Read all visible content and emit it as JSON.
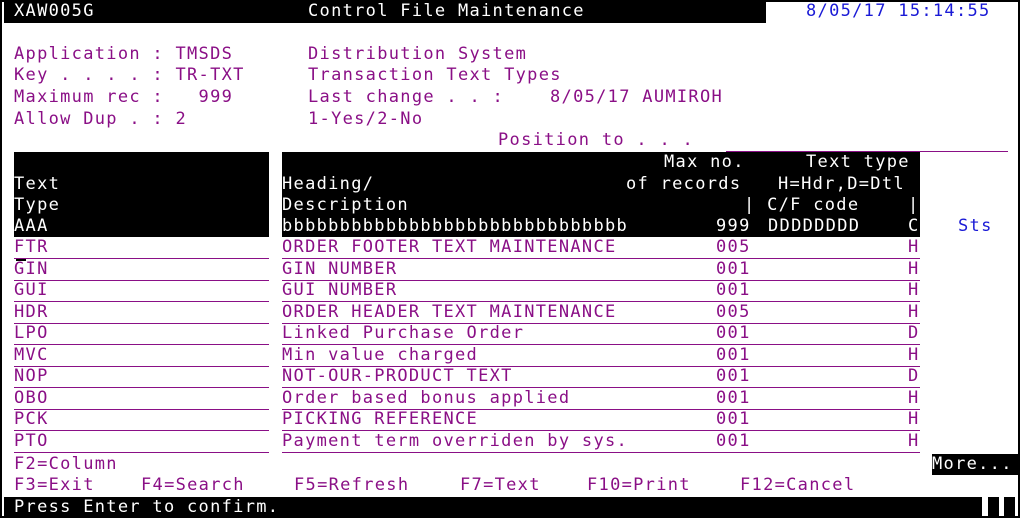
{
  "header": {
    "program": "XAW005G",
    "title": "Control File Maintenance",
    "datetime": "8/05/17 15:14:55"
  },
  "info": {
    "application_label": "Application : TMSDS",
    "application_desc": "Distribution System",
    "key_label": "Key . . . . : TR-TXT",
    "key_desc": "Transaction Text Types",
    "maxrec_label": "Maximum rec :   999",
    "last_change_label": "Last change . . :",
    "last_change_value": "8/05/17 AUMIROH",
    "allowdup_label": "Allow Dup . : 2",
    "allowdup_desc": "1-Yes/2-No"
  },
  "position_to": {
    "label": "Position to . . .",
    "value": ""
  },
  "columns": {
    "text_l2": "Text",
    "text_l3": "Type",
    "text_l4": "AAA",
    "heading_l2": "Heading/",
    "heading_l3": "Description",
    "heading_l4": "bbbbbbbbbbbbbbbbbbbbbbbbbbbbbb",
    "maxno_l1": "Max no.",
    "maxno_l2": "of records",
    "maxno_l4": "999",
    "texttype_l1": "Text type",
    "texttype_l2": "H=Hdr,D=Dtl",
    "cfcode_l3": "| C/F code",
    "cfcode_l4": "DDDDDDDD",
    "pipe_right": "|",
    "c_l4": "C",
    "sts": "Sts"
  },
  "rows": [
    {
      "type": "FTR",
      "description": "ORDER FOOTER TEXT MAINTENANCE",
      "max": "005",
      "cf": "",
      "hd": "H"
    },
    {
      "type": "GIN",
      "description": "GIN NUMBER",
      "max": "001",
      "cf": "",
      "hd": "H"
    },
    {
      "type": "GUI",
      "description": "GUI NUMBER",
      "max": "001",
      "cf": "",
      "hd": "H"
    },
    {
      "type": "HDR",
      "description": "ORDER HEADER TEXT MAINTENANCE",
      "max": "005",
      "cf": "",
      "hd": "H"
    },
    {
      "type": "LPO",
      "description": "Linked Purchase Order",
      "max": "001",
      "cf": "",
      "hd": "D"
    },
    {
      "type": "MVC",
      "description": "Min value charged",
      "max": "001",
      "cf": "",
      "hd": "H"
    },
    {
      "type": "NOP",
      "description": "NOT-OUR-PRODUCT TEXT",
      "max": "001",
      "cf": "",
      "hd": "D"
    },
    {
      "type": "OBO",
      "description": "Order based bonus applied",
      "max": "001",
      "cf": "",
      "hd": "H"
    },
    {
      "type": "PCK",
      "description": "PICKING REFERENCE",
      "max": "001",
      "cf": "",
      "hd": "H"
    },
    {
      "type": "PTO",
      "description": "Payment term overriden by sys.",
      "max": "001",
      "cf": "",
      "hd": "H"
    }
  ],
  "footer": {
    "f2": "F2=Column",
    "more": "More...",
    "f3": "F3=Exit",
    "f4": "F4=Search",
    "f5": "F5=Refresh",
    "f7": "F7=Text",
    "f10": "F10=Print",
    "f12": "F12=Cancel",
    "message": "Press Enter to confirm."
  }
}
